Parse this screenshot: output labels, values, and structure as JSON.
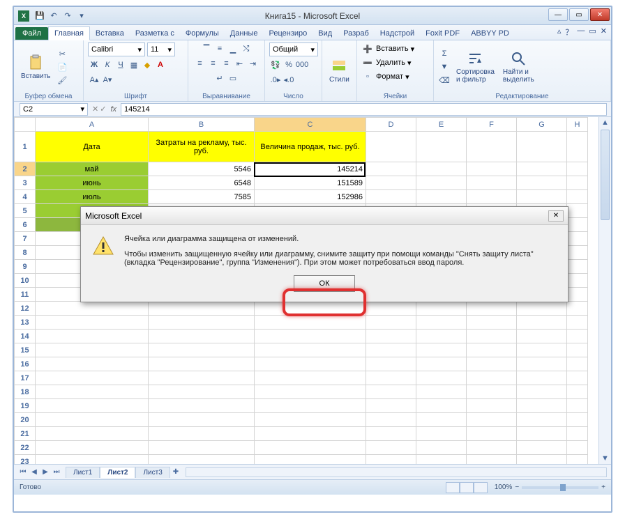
{
  "window": {
    "title": "Книга15 - Microsoft Excel"
  },
  "tabs": {
    "file": "Файл",
    "items": [
      "Главная",
      "Вставка",
      "Разметка с",
      "Формулы",
      "Данные",
      "Рецензиро",
      "Вид",
      "Разраб",
      "Надстрой",
      "Foxit PDF",
      "ABBYY PD"
    ],
    "active": 0
  },
  "ribbon": {
    "clipboard": {
      "paste": "Вставить",
      "label": "Буфер обмена"
    },
    "font": {
      "name": "Calibri",
      "size": "11",
      "label": "Шрифт"
    },
    "align": {
      "label": "Выравнивание"
    },
    "number": {
      "format": "Общий",
      "label": "Число"
    },
    "styles": {
      "btn": "Стили",
      "label": ""
    },
    "cells": {
      "insert": "Вставить",
      "delete": "Удалить",
      "format": "Формат",
      "label": "Ячейки"
    },
    "editing": {
      "sort": "Сортировка\nи фильтр",
      "find": "Найти и\nвыделить",
      "label": "Редактирование"
    }
  },
  "namebox": "C2",
  "formula": "145214",
  "columns": [
    "A",
    "B",
    "C",
    "D",
    "E",
    "F",
    "G",
    "H"
  ],
  "header_row": {
    "A": "Дата",
    "B": "Затраты на рекламу, тыс. руб.",
    "C": "Величина продаж, тыс. руб."
  },
  "rows": [
    {
      "n": "2",
      "A": "май",
      "B": "5546",
      "C": "145214"
    },
    {
      "n": "3",
      "A": "июнь",
      "B": "6548",
      "C": "151589"
    },
    {
      "n": "4",
      "A": "июль",
      "B": "7585",
      "C": "152986"
    }
  ],
  "blank_rows": [
    "5",
    "6",
    "7",
    "8",
    "9",
    "10",
    "11",
    "12",
    "13",
    "14",
    "15",
    "16",
    "17",
    "18",
    "19",
    "20",
    "21",
    "22",
    "23"
  ],
  "sheets": [
    "Лист1",
    "Лист2",
    "Лист3"
  ],
  "active_sheet": 1,
  "status": {
    "ready": "Готово",
    "zoom": "100%"
  },
  "dialog": {
    "title": "Microsoft Excel",
    "line1": "Ячейка или диаграмма защищена от изменений.",
    "line2": "Чтобы изменить защищенную ячейку или диаграмму, снимите защиту при помощи команды \"Снять защиту листа\" (вкладка \"Рецензирование\", группа \"Изменения\"). При этом может потребоваться ввод пароля.",
    "ok": "ОК"
  }
}
